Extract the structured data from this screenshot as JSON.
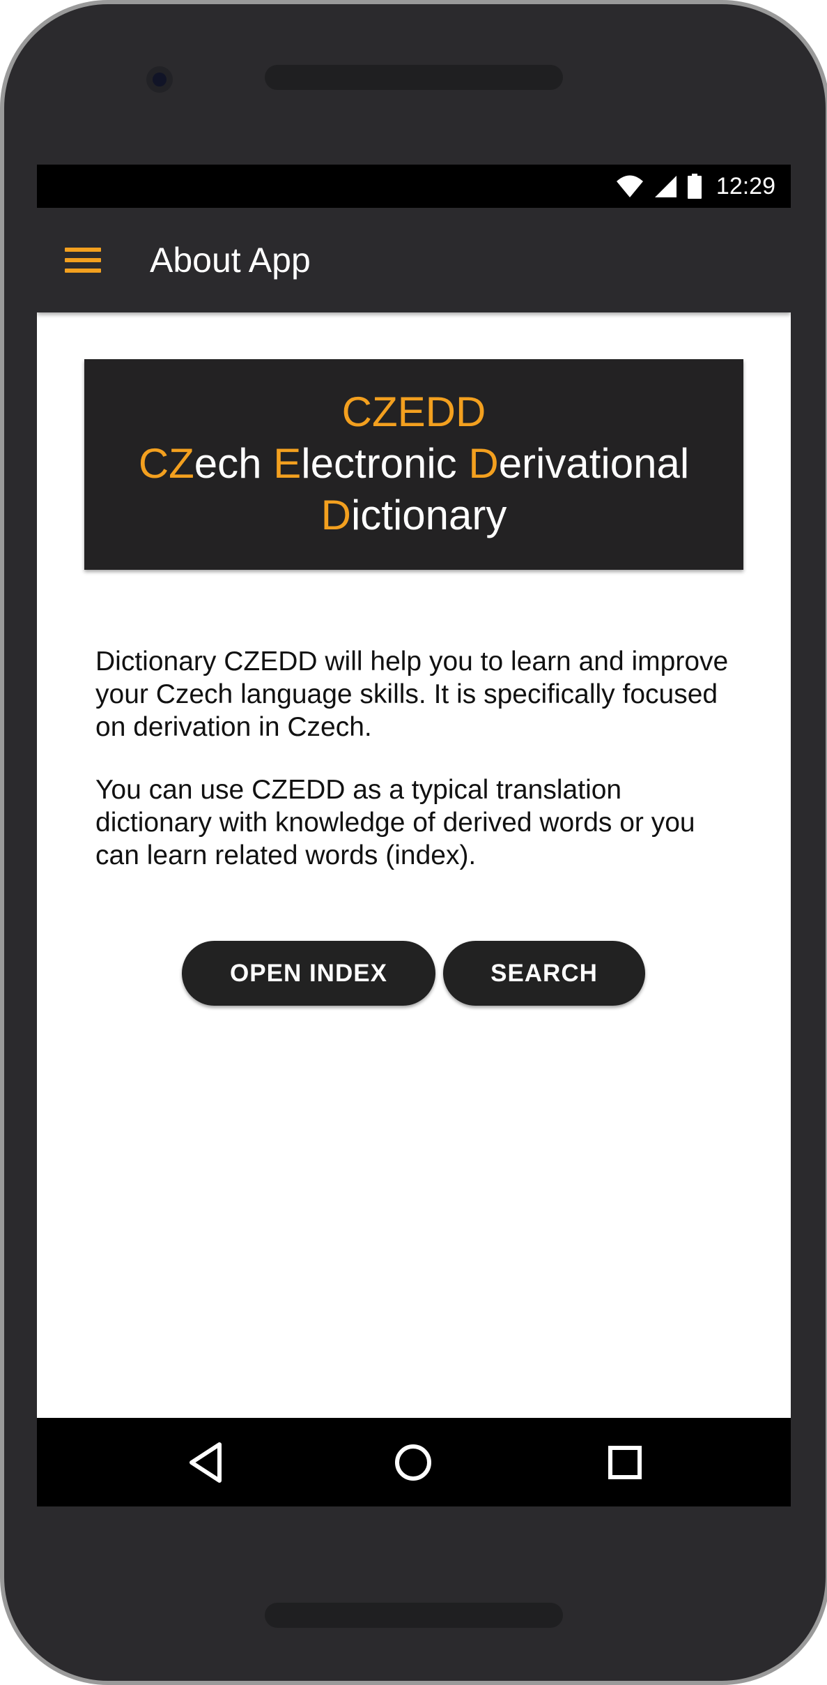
{
  "status_bar": {
    "time": "12:29",
    "icons": [
      "wifi-icon",
      "cell-signal-icon",
      "battery-icon"
    ]
  },
  "app_bar": {
    "menu_icon": "menu-icon",
    "title": "About App"
  },
  "banner": {
    "acronym": "CZEDD",
    "line2": [
      {
        "text": "CZ",
        "accent": true
      },
      {
        "text": "ech ",
        "accent": false
      },
      {
        "text": "E",
        "accent": true
      },
      {
        "text": "lectronic ",
        "accent": false
      },
      {
        "text": "D",
        "accent": true
      },
      {
        "text": "erivational",
        "accent": false
      }
    ],
    "line3": [
      {
        "text": "D",
        "accent": true
      },
      {
        "text": "ictionary",
        "accent": false
      }
    ]
  },
  "description": {
    "paragraph1": "Dictionary CZEDD will help you to learn and improve your Czech language skills. It is specifically focused on derivation in Czech.",
    "paragraph2": "You can use CZEDD as a typical translation dictionary with knowledge of derived words or you can learn related words (index)."
  },
  "buttons": {
    "open_index": "OPEN INDEX",
    "search": "SEARCH"
  },
  "nav_bar": {
    "icons": [
      "back-icon",
      "home-icon",
      "recents-icon"
    ]
  },
  "colors": {
    "accent": "#f3a01f",
    "app_bar": "#2b2a2d",
    "banner": "#232223",
    "button": "#222222"
  }
}
